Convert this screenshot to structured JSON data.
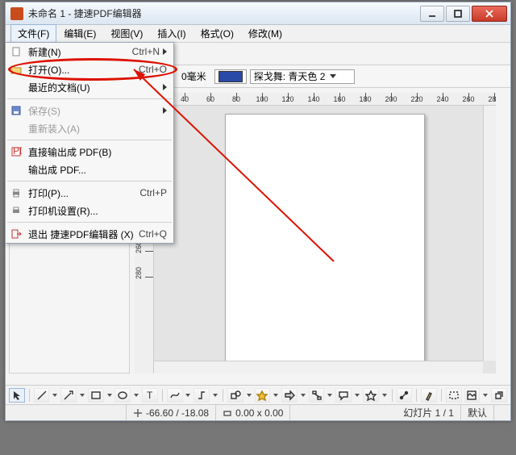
{
  "window": {
    "title": "未命名 1 - 捷速PDF编辑器"
  },
  "menubar": {
    "items": [
      {
        "label": "文件(F)"
      },
      {
        "label": "编辑(E)"
      },
      {
        "label": "视图(V)"
      },
      {
        "label": "插入(I)"
      },
      {
        "label": "格式(O)"
      },
      {
        "label": "修改(M)"
      }
    ]
  },
  "file_menu": {
    "items": [
      {
        "icon": "doc-new-icon",
        "label": "新建(N)",
        "shortcut": "Ctrl+N",
        "submenu": true
      },
      {
        "icon": "folder-open-icon",
        "label": "打开(O)...",
        "shortcut": "Ctrl+O"
      },
      {
        "icon": "",
        "label": "最近的文档(U)",
        "shortcut": "",
        "submenu": true
      },
      {
        "sep": true
      },
      {
        "icon": "save-icon",
        "label": "保存(S)",
        "shortcut": "",
        "disabled": true,
        "submenu": true
      },
      {
        "icon": "",
        "label": "重新装入(A)",
        "shortcut": "",
        "disabled": true
      },
      {
        "sep": true
      },
      {
        "icon": "pdf-icon",
        "label": "直接输出成 PDF(B)",
        "shortcut": ""
      },
      {
        "icon": "",
        "label": "输出成 PDF...",
        "shortcut": ""
      },
      {
        "sep": true
      },
      {
        "icon": "printer-icon",
        "label": "打印(P)...",
        "shortcut": "Ctrl+P"
      },
      {
        "icon": "printer-gear-icon",
        "label": "打印机设置(R)...",
        "shortcut": ""
      },
      {
        "sep": true
      },
      {
        "icon": "exit-icon",
        "label": "退出 捷速PDF编辑器 (X)",
        "shortcut": "Ctrl+Q"
      }
    ]
  },
  "toolbar2": {
    "left_value": "0",
    "unit_label": "0毫米",
    "combo_label": "探戈舞: 青天色 2"
  },
  "ruler_h": {
    "start": 20,
    "step": 20,
    "count": 14
  },
  "ruler_v": {
    "start": 160,
    "step": 20,
    "count": 7
  },
  "statusbar": {
    "coords": "-66.60 / -18.08",
    "size": "0.00 x 0.00",
    "slide": "幻灯片 1 / 1",
    "mode": "默认"
  }
}
